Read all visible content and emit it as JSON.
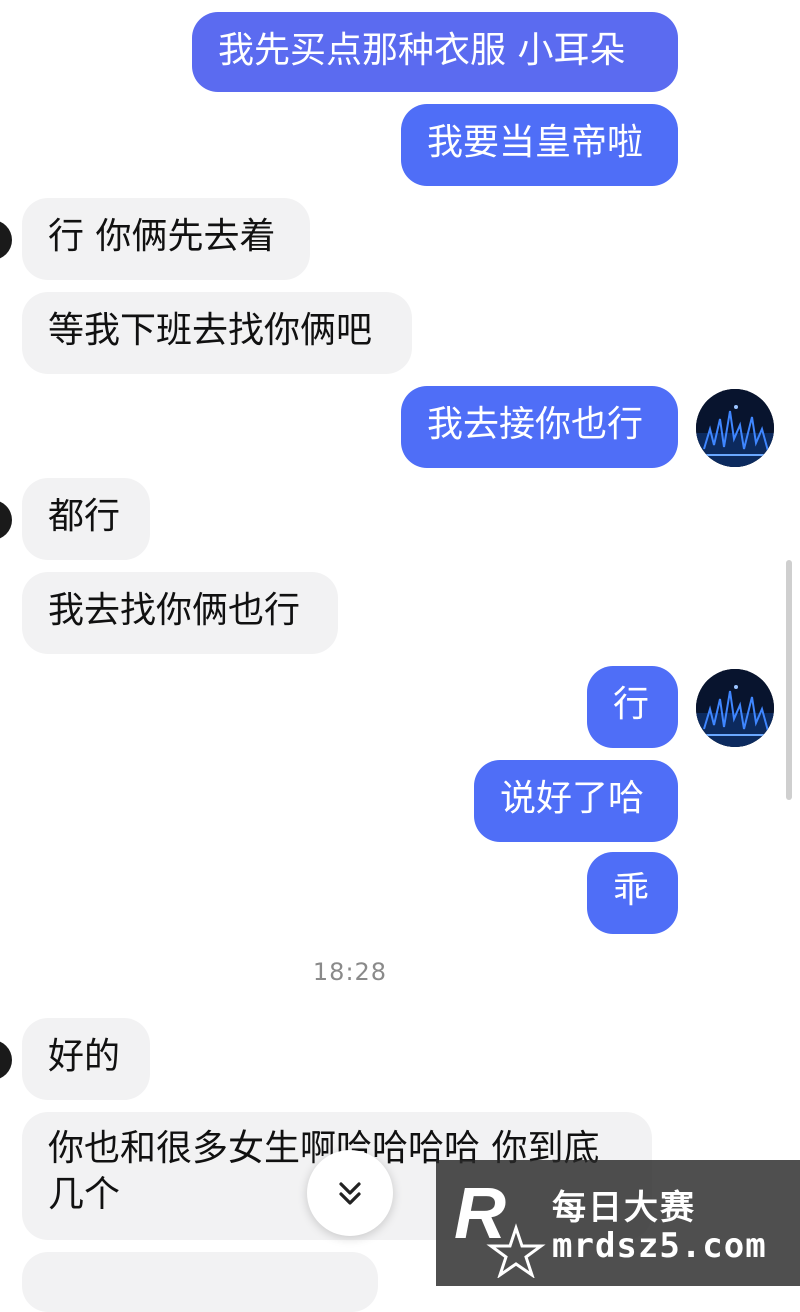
{
  "messages": [
    {
      "side": "out",
      "text": "我先买点那种衣服 小耳朵"
    },
    {
      "side": "out",
      "text": "我要当皇帝啦"
    },
    {
      "side": "in",
      "text": "行 你俩先去着"
    },
    {
      "side": "in",
      "text": "等我下班去找你俩吧"
    },
    {
      "side": "out",
      "text": "我去接你也行"
    },
    {
      "side": "in",
      "text": "都行"
    },
    {
      "side": "in",
      "text": "我去找你俩也行"
    },
    {
      "side": "out",
      "text": "行"
    },
    {
      "side": "out",
      "text": "说好了哈"
    },
    {
      "side": "out",
      "text": "乖"
    },
    {
      "side": "in",
      "text": "好的"
    },
    {
      "side": "in",
      "text": "你也和很多女生啊哈哈哈哈 你到底几个"
    }
  ],
  "timestamp": "18:28",
  "scroll_down": {
    "icon": "double-chevron-down-icon"
  },
  "watermark": {
    "logo": "R",
    "line1": "每日大赛",
    "line2": "mrdsz5.com"
  },
  "colors": {
    "outgoing": "#4f6ef7",
    "incoming": "#f2f2f3",
    "timestamp": "#8a8a8a"
  }
}
